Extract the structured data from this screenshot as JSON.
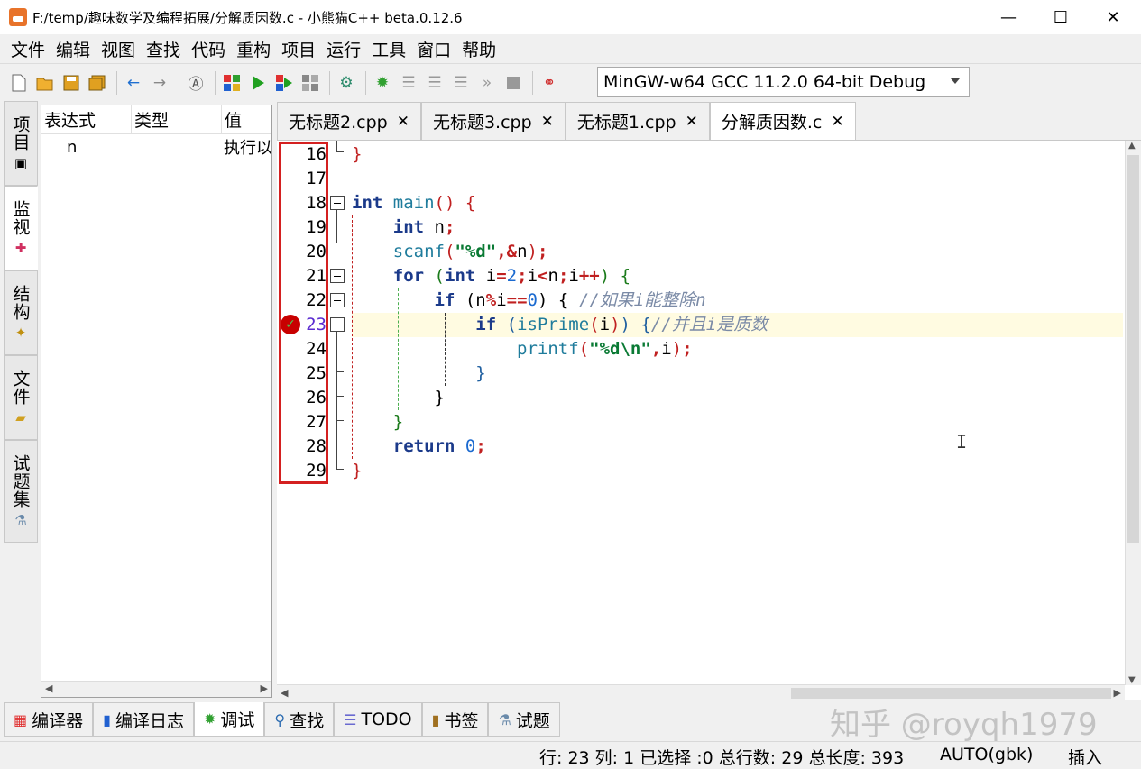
{
  "window": {
    "title": "F:/temp/趣味数学及编程拓展/分解质因数.c - 小熊猫C++ beta.0.12.6",
    "minimize": "—",
    "maximize": "☐",
    "close": "✕"
  },
  "menu": [
    "文件",
    "编辑",
    "视图",
    "查找",
    "代码",
    "重构",
    "项目",
    "运行",
    "工具",
    "窗口",
    "帮助"
  ],
  "toolbar": {
    "compiler": "MinGW-w64 GCC 11.2.0 64-bit Debug"
  },
  "sidetabs": [
    {
      "label": "项目",
      "icon": "project-icon"
    },
    {
      "label": "监视",
      "icon": "watch-icon"
    },
    {
      "label": "结构",
      "icon": "structure-icon"
    },
    {
      "label": "文件",
      "icon": "folder-icon"
    },
    {
      "label": "试题集",
      "icon": "problem-set-icon"
    }
  ],
  "watch": {
    "headers": [
      "表达式",
      "类型",
      "值"
    ],
    "rows": [
      {
        "expr": "n",
        "type": "",
        "value": "执行以"
      }
    ]
  },
  "filetabs": [
    "无标题2.cpp",
    "无标题3.cpp",
    "无标题1.cpp",
    "分解质因数.c"
  ],
  "editor": {
    "line_numbers": [
      "16",
      "17",
      "18",
      "19",
      "20",
      "21",
      "22",
      "23",
      "24",
      "25",
      "26",
      "27",
      "28",
      "29"
    ],
    "current_line": "23"
  },
  "bottomtabs": [
    "编译器",
    "编译日志",
    "调试",
    "查找",
    "TODO",
    "书签",
    "试题"
  ],
  "status": {
    "position": "行: 23 列: 1 已选择 :0 总行数: 29 总长度: 393",
    "encoding": "AUTO(gbk)",
    "mode": "插入"
  },
  "watermark": "知乎 @royqh1979"
}
